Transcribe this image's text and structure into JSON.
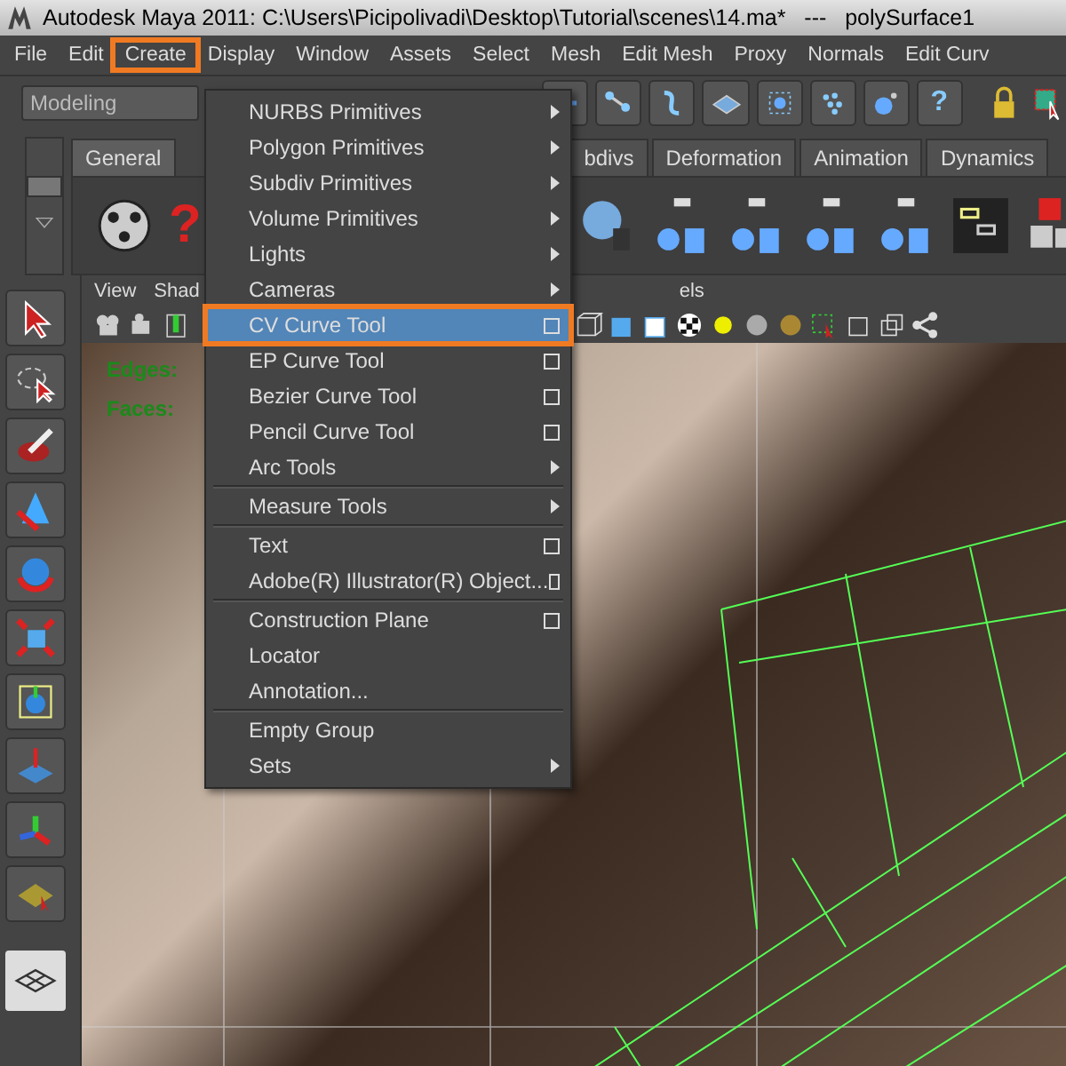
{
  "window": {
    "title": "Autodesk Maya 2011: C:\\Users\\Picipolivadi\\Desktop\\Tutorial\\scenes\\14.ma*   ---   polySurface1"
  },
  "menu_bar": [
    {
      "label": "File",
      "selected": false
    },
    {
      "label": "Edit",
      "selected": false
    },
    {
      "label": "Create",
      "selected": true
    },
    {
      "label": "Display",
      "selected": false
    },
    {
      "label": "Window",
      "selected": false
    },
    {
      "label": "Assets",
      "selected": false
    },
    {
      "label": "Select",
      "selected": false
    },
    {
      "label": "Mesh",
      "selected": false
    },
    {
      "label": "Edit Mesh",
      "selected": false
    },
    {
      "label": "Proxy",
      "selected": false
    },
    {
      "label": "Normals",
      "selected": false
    },
    {
      "label": "Edit Curv",
      "selected": false
    }
  ],
  "status_line": {
    "mode": "Modeling",
    "help_glyph": "?"
  },
  "shelf": {
    "help_glyph": "?"
  },
  "shelf_tabs": [
    {
      "label": "General",
      "selected": true
    },
    {
      "label": "bdivs",
      "selected": false
    },
    {
      "label": "Deformation",
      "selected": false
    },
    {
      "label": "Animation",
      "selected": false
    },
    {
      "label": "Dynamics",
      "selected": false
    }
  ],
  "viewport": {
    "menu": [
      "View",
      "Shad",
      "els"
    ],
    "hud": [
      "Edges:",
      "Faces:"
    ]
  },
  "create_menu": [
    {
      "label": "NURBS Primitives",
      "kind": "submenu",
      "highlighted": false,
      "separator_before": false
    },
    {
      "label": "Polygon Primitives",
      "kind": "submenu",
      "highlighted": false,
      "separator_before": false
    },
    {
      "label": "Subdiv Primitives",
      "kind": "submenu",
      "highlighted": false,
      "separator_before": false
    },
    {
      "label": "Volume Primitives",
      "kind": "submenu",
      "highlighted": false,
      "separator_before": false
    },
    {
      "label": "Lights",
      "kind": "submenu",
      "highlighted": false,
      "separator_before": false
    },
    {
      "label": "Cameras",
      "kind": "submenu",
      "highlighted": false,
      "separator_before": false
    },
    {
      "label": "CV Curve Tool",
      "kind": "option",
      "highlighted": true,
      "separator_before": false
    },
    {
      "label": "EP Curve Tool",
      "kind": "option",
      "highlighted": false,
      "separator_before": false
    },
    {
      "label": "Bezier Curve Tool",
      "kind": "option",
      "highlighted": false,
      "separator_before": false
    },
    {
      "label": "Pencil Curve Tool",
      "kind": "option",
      "highlighted": false,
      "separator_before": false
    },
    {
      "label": "Arc Tools",
      "kind": "submenu",
      "highlighted": false,
      "separator_before": false
    },
    {
      "label": "Measure Tools",
      "kind": "submenu",
      "highlighted": false,
      "separator_before": true
    },
    {
      "label": "Text",
      "kind": "option",
      "highlighted": false,
      "separator_before": true
    },
    {
      "label": "Adobe(R) Illustrator(R) Object...",
      "kind": "option",
      "highlighted": false,
      "separator_before": false
    },
    {
      "label": "Construction Plane",
      "kind": "option",
      "highlighted": false,
      "separator_before": true
    },
    {
      "label": "Locator",
      "kind": "plain",
      "highlighted": false,
      "separator_before": false
    },
    {
      "label": "Annotation...",
      "kind": "plain",
      "highlighted": false,
      "separator_before": false
    },
    {
      "label": "Empty Group",
      "kind": "plain",
      "highlighted": false,
      "separator_before": true
    },
    {
      "label": "Sets",
      "kind": "submenu",
      "highlighted": false,
      "separator_before": false
    }
  ]
}
